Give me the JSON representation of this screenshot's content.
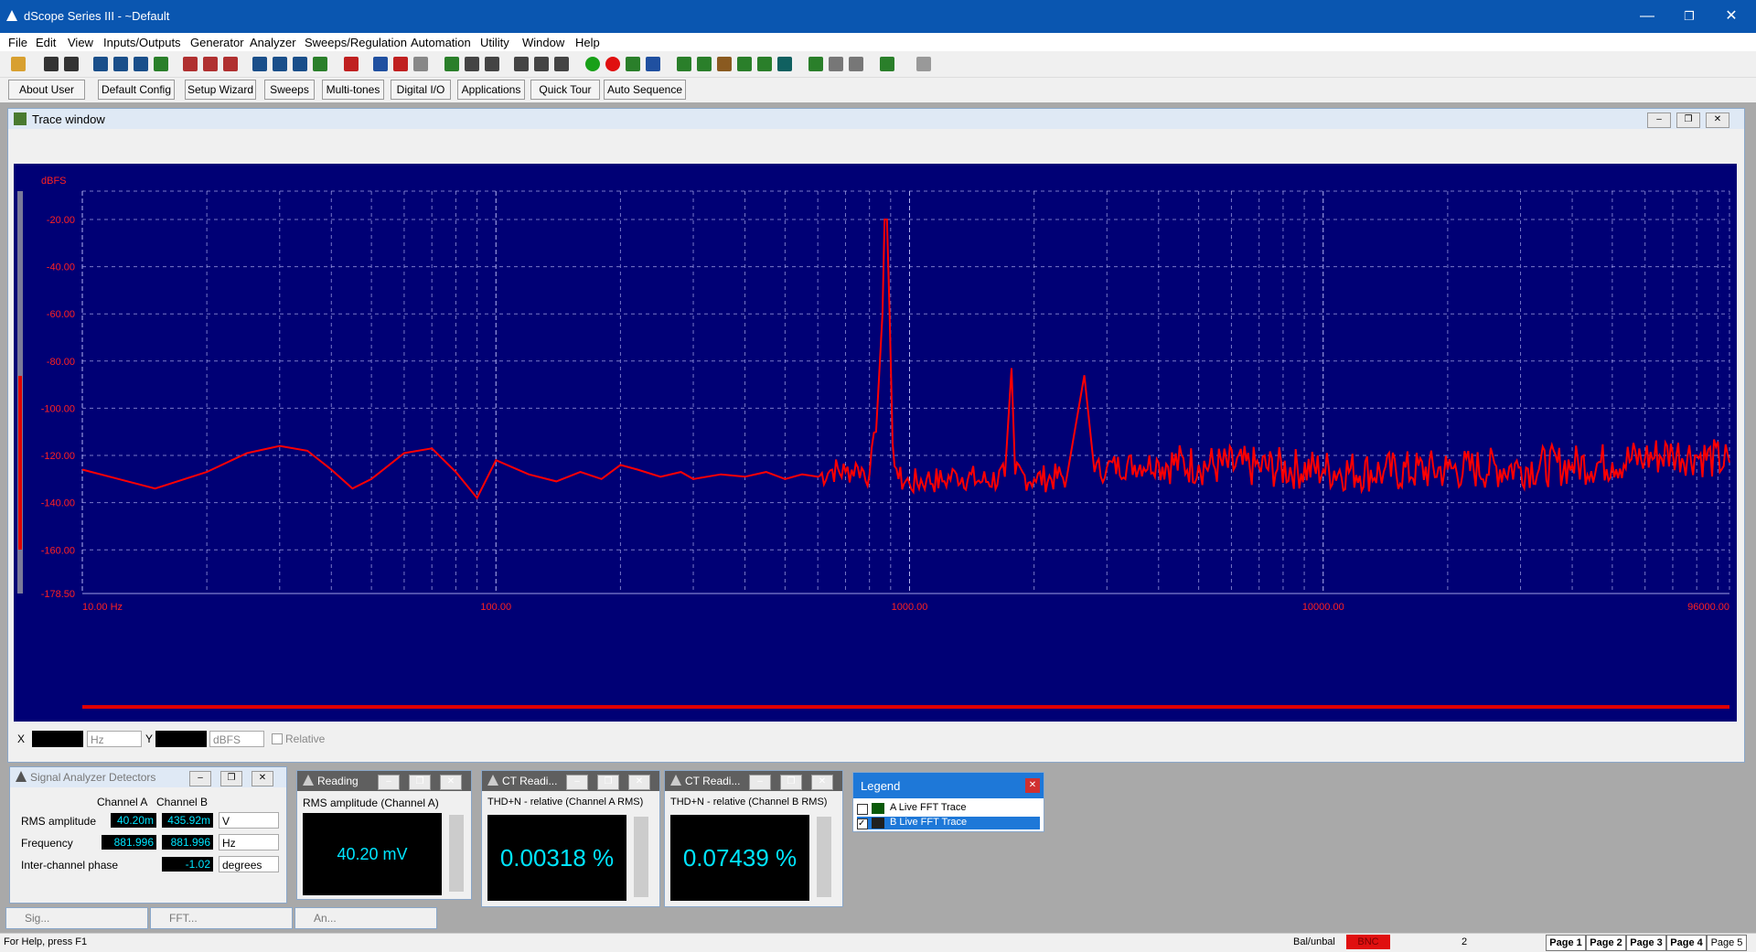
{
  "window": {
    "title": "dScope Series III - ~Default",
    "min": "—",
    "max": "❐",
    "close": "✕"
  },
  "menu": [
    "File",
    "Edit",
    "View",
    "Inputs/Outputs",
    "Generator",
    "Analyzer",
    "Sweeps/Regulation",
    "Automation",
    "Utility",
    "Window",
    "Help"
  ],
  "userbar": [
    "About User Bar",
    "Default Config",
    "Setup Wizard",
    "Sweeps",
    "Multi-tones",
    "Digital I/O",
    "Applications",
    "Quick Tour",
    "Auto Sequence"
  ],
  "trace_window": {
    "title": "Trace window"
  },
  "chart_data": {
    "type": "line",
    "ylabel": "dBFS",
    "x_scale": "log",
    "xlim": [
      10,
      96000
    ],
    "ylim": [
      -178.5,
      -8
    ],
    "y_ticks": [
      "-20.00",
      "-40.00",
      "-60.00",
      "-80.00",
      "-100.00",
      "-120.00",
      "-140.00",
      "-160.00",
      "-178.50"
    ],
    "x_ticks": [
      "10.00 Hz",
      "100.00",
      "1000.00",
      "10000.00",
      "96000.00"
    ],
    "grid": true,
    "series": [
      {
        "color": "#ff0000",
        "x": [
          10,
          15,
          20,
          25,
          30,
          35,
          40,
          45,
          50,
          60,
          70,
          80,
          90,
          100,
          120,
          140,
          160,
          180,
          200,
          220,
          250,
          280,
          300,
          350,
          400,
          450,
          500,
          550,
          600,
          650,
          700,
          750,
          800,
          830,
          860,
          870,
          882,
          895,
          910,
          940,
          1000,
          1100,
          1200,
          1300,
          1500,
          1700,
          1764,
          1800,
          2000,
          2400,
          2646,
          2800,
          3000,
          4000,
          5000,
          7000,
          10000,
          14000,
          20000,
          30000,
          40000,
          50000,
          60000,
          70000,
          80000,
          96000
        ],
        "y": [
          -126,
          -134,
          -127,
          -119,
          -116,
          -118,
          -126,
          -134,
          -130,
          -119,
          -117,
          -127,
          -138,
          -122,
          -128,
          -131,
          -127,
          -130,
          -124,
          -126,
          -129,
          -127,
          -130,
          -128,
          -129,
          -127,
          -130,
          -128,
          -129,
          -126,
          -127,
          -125,
          -128,
          -110,
          -60,
          -20,
          -20,
          -60,
          -115,
          -130,
          -132,
          -130,
          -131,
          -128,
          -131,
          -129,
          -83,
          -128,
          -130,
          -129,
          -86,
          -127,
          -125,
          -123,
          -124,
          -125,
          -126,
          -127,
          -126,
          -125,
          -124,
          -123,
          -121,
          -119,
          -120,
          -123
        ]
      }
    ]
  },
  "readout": {
    "x_label": "X",
    "x_unit": "Hz",
    "y_label": "Y",
    "y_unit": "dBFS",
    "relative": "Relative"
  },
  "detectors": {
    "title": "Signal Analyzer Detectors",
    "col_a": "Channel A",
    "col_b": "Channel B",
    "rows": [
      {
        "label": "RMS amplitude",
        "a": "40.20m",
        "b": "435.92m",
        "unit": "V"
      },
      {
        "label": "Frequency",
        "a": "881.996",
        "b": "881.996",
        "unit": "Hz"
      },
      {
        "label": "Inter-channel phase",
        "a": "",
        "b": "-1.02",
        "unit": "degrees"
      }
    ]
  },
  "reading1": {
    "title": "Reading",
    "caption": "RMS amplitude (Channel A)",
    "value": "40.20 mV"
  },
  "reading2": {
    "title": "CT Readi...",
    "caption": "THD+N - relative (Channel A RMS)",
    "value": "0.00318 %"
  },
  "reading3": {
    "title": "CT Readi...",
    "caption": "THD+N - relative (Channel B RMS)",
    "value": "0.07439 %"
  },
  "legend": {
    "title": "Legend",
    "items": [
      {
        "label": "A  Live FFT Trace",
        "checked": false
      },
      {
        "label": "B  Live FFT Trace",
        "checked": true
      }
    ]
  },
  "minimized": [
    "Sig...",
    "FFT...",
    "An..."
  ],
  "status": {
    "help": "For Help, press F1",
    "balunbal": "Bal/unbal",
    "bnc": "BNC",
    "number": "2",
    "pages": [
      "Page 1",
      "Page 2",
      "Page 3",
      "Page 4",
      "Page 5"
    ]
  },
  "colors": {
    "plot_bg": "#000075",
    "trace": "#ff0000",
    "readout_text": "#00e5ff",
    "titlebar": "#0a56b0"
  }
}
